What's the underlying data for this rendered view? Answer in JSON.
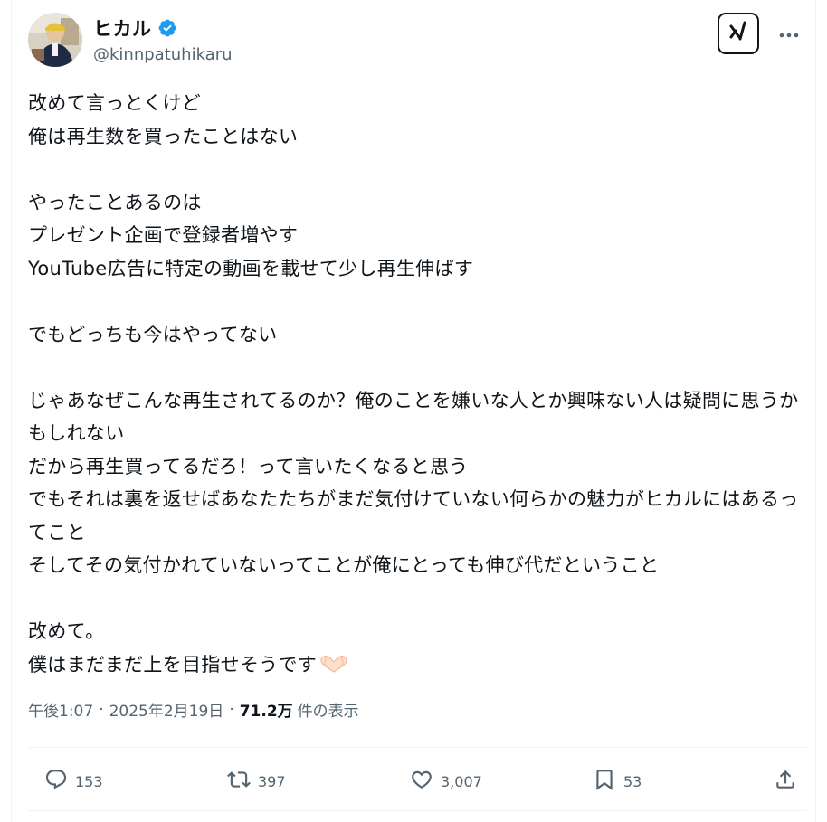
{
  "author": {
    "display_name": "ヒカル",
    "handle": "@kinnpatuhikaru",
    "verified": true
  },
  "icons": {
    "verified": "verified-badge-icon",
    "grok": "grok-icon",
    "more": "more-horizontal-icon",
    "reply": "reply-icon",
    "retweet": "retweet-icon",
    "like": "heart-icon",
    "bookmark": "bookmark-icon",
    "share": "share-icon",
    "emoji": "heart-hands-emoji"
  },
  "colors": {
    "accent_blue": "#1d9bf0",
    "text_primary": "#0f1419",
    "text_secondary": "#536471"
  },
  "tweet": {
    "text": "改めて言っとくけど\n俺は再生数を買ったことはない\n\nやったことあるのは\nプレゼント企画で登録者増やす\nYouTube広告に特定の動画を載せて少し再生伸ばす\n\nでもどっちも今はやってない\n\nじゃあなぜこんな再生されてるのか？俺のことを嫌いな人とか興味ない人は疑問に思うかもしれない\nだから再生買ってるだろ！って言いたくなると思う\nでもそれは裏を返せばあなたたちがまだ気付けていない何らかの魅力がヒカルにはあるってこと\nそしてその気付かれていないってことが俺にとっても伸び代だということ\n\n改めて。\n僕はまだまだ上を目指せそうです"
  },
  "meta": {
    "time": "午後1:07",
    "separator": "·",
    "date": "2025年2月19日",
    "views_count": "71.2万",
    "views_label": "件の表示"
  },
  "stats": {
    "replies": "153",
    "retweets": "397",
    "likes": "3,007",
    "bookmarks": "53"
  }
}
